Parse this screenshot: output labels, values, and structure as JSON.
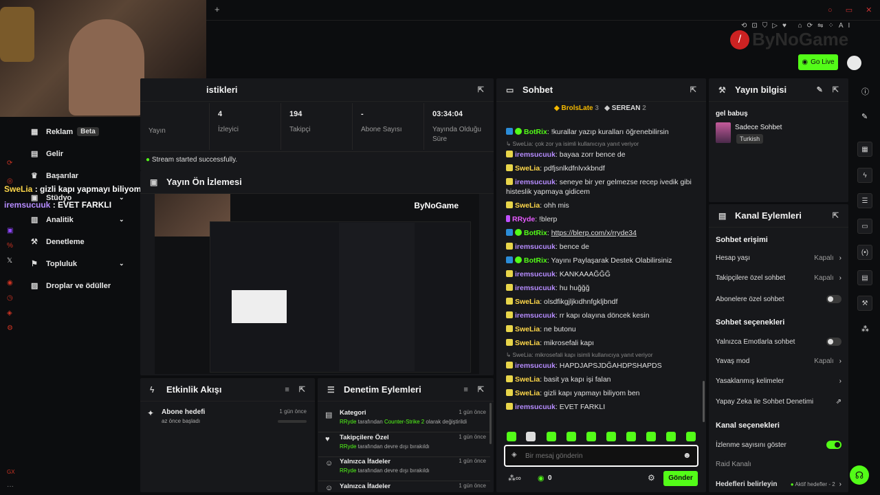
{
  "topbar": {
    "plus_icon": "plus-icon",
    "brand": "ByNoGame",
    "go_live_label": "Go Live",
    "ai_label": "AI"
  },
  "stats": {
    "title": "istikleri",
    "items": [
      {
        "value": "4",
        "label": "İzleyici"
      },
      {
        "value": "194",
        "label": "Takipçi"
      },
      {
        "value": "-",
        "label": "Abone Sayısı"
      },
      {
        "value": "03:34:04",
        "label": "Yayında Olduğu Süre"
      }
    ],
    "yayin_label": "Yayın",
    "status_message": "Stream started successfully."
  },
  "preview": {
    "title": "Yayın Ön İzlemesi",
    "brand": "ByNoGame"
  },
  "sidebar": {
    "items": [
      {
        "label": "Reklam",
        "badge": "Beta"
      },
      {
        "label": "Gelir"
      },
      {
        "label": "Başarılar"
      },
      {
        "label": "Stüdyo"
      },
      {
        "label": "Analitik"
      },
      {
        "label": "Denetleme"
      },
      {
        "label": "Topluluk"
      },
      {
        "label": "Droplar ve ödüller"
      }
    ],
    "overlay": [
      {
        "user": "SweLia",
        "text": "gizli kapı yapmayı biliyom ben"
      },
      {
        "user": "iremsucuuk",
        "text": "EVET FARKLI"
      }
    ]
  },
  "activity": {
    "title": "Etkinlik Akışı",
    "item_title": "Abone hedefi",
    "item_sub": "az önce başladı",
    "item_time": "1 gün önce"
  },
  "moderation": {
    "title": "Denetim Eylemleri",
    "items": [
      {
        "title": "Kategori",
        "user": "RRyde",
        "mid": " tarafından ",
        "hl": "Counter-Strike 2",
        "tail": " olarak değiştirildi",
        "time": "1 gün önce"
      },
      {
        "title": "Takipçilere Özel",
        "user": "RRyde",
        "mid": " tarafından devre dışı bırakıldı",
        "hl": "",
        "tail": "",
        "time": "1 gün önce"
      },
      {
        "title": "Yalnızca İfadeler",
        "user": "RRyde",
        "mid": " tarafından devre dışı bırakıldı",
        "hl": "",
        "tail": "",
        "time": "1 gün önce"
      },
      {
        "title": "Yalnızca İfadeler",
        "user": "",
        "mid": "",
        "hl": "",
        "tail": "",
        "time": "1 gün önce"
      }
    ]
  },
  "chat": {
    "title": "Sohbet",
    "leaders": [
      {
        "name": "BrolsLate",
        "count": "3"
      },
      {
        "name": "SEREAN",
        "count": "2"
      }
    ],
    "messages": [
      {
        "user": "BotRix",
        "color": "#53fc18",
        "text": "!kurallar yazıp kuralları öğrenebilirsin",
        "reply": ""
      },
      {
        "user": "iremsucuuk",
        "color": "#b68cff",
        "text": "bayaa zorr bence de",
        "reply": "SweLia: çok zor ya isimli kullanıcıya yanıt veriyor"
      },
      {
        "user": "SweLia",
        "color": "#ffd84a",
        "text": "pdfjsnlkdfnlvxkbndf",
        "reply": ""
      },
      {
        "user": "iremsucuuk",
        "color": "#b68cff",
        "text": "seneye bir yer gelmezse recep ivedik gibi histeslik yapmaya gidicem",
        "reply": ""
      },
      {
        "user": "SweLia",
        "color": "#ffd84a",
        "text": "ohh mis",
        "reply": ""
      },
      {
        "user": "RRyde",
        "color": "#e65bff",
        "text": "!blerp",
        "reply": ""
      },
      {
        "user": "BotRix",
        "color": "#53fc18",
        "text": "https://blerp.com/x/rryde34",
        "reply": ""
      },
      {
        "user": "iremsucuuk",
        "color": "#b68cff",
        "text": "bence de",
        "reply": ""
      },
      {
        "user": "BotRix",
        "color": "#53fc18",
        "text": "Yayını Paylaşarak Destek Olabilirsiniz",
        "reply": ""
      },
      {
        "user": "iremsucuuk",
        "color": "#b68cff",
        "text": "KANKAAAĞĞĞ",
        "reply": ""
      },
      {
        "user": "iremsucuuk",
        "color": "#b68cff",
        "text": "hu huğğğ",
        "reply": ""
      },
      {
        "user": "SweLia",
        "color": "#ffd84a",
        "text": "olsdfikgjljkıdhnfgkljbndf",
        "reply": ""
      },
      {
        "user": "iremsucuuk",
        "color": "#b68cff",
        "text": "rr kapı olayına döncek kesin",
        "reply": ""
      },
      {
        "user": "SweLia",
        "color": "#ffd84a",
        "text": "ne butonu",
        "reply": ""
      },
      {
        "user": "SweLia",
        "color": "#ffd84a",
        "text": "mikrosefali kapı",
        "reply": ""
      },
      {
        "user": "iremsucuuk",
        "color": "#b68cff",
        "text": "HAPDJAPSJDĞAHDPSHAPDS",
        "reply": "SweLia: mikrosefali kapı isimli kullanıcıya yanıt veriyor"
      },
      {
        "user": "SweLia",
        "color": "#ffd84a",
        "text": "basit ya kapı işi falan",
        "reply": ""
      },
      {
        "user": "SweLia",
        "color": "#ffd84a",
        "text": "gizli kapı yapmayı biliyom ben",
        "reply": ""
      },
      {
        "user": "iremsucuuk",
        "color": "#b68cff",
        "text": "EVET FARKLI",
        "reply": ""
      }
    ],
    "input_placeholder": "Bir mesaj gönderin",
    "points": "0",
    "send_label": "Gönder"
  },
  "stream_info": {
    "title": "Yayın bilgisi",
    "stream_title": "gel babuş",
    "category": "Sadece Sohbet",
    "language": "Turkish"
  },
  "channel_actions": {
    "title": "Kanal Eylemleri",
    "chat_access": "Sohbet erişimi",
    "account_age": "Hesap yaşı",
    "account_age_value": "Kapalı",
    "followers_only": "Takipçilere özel sohbet",
    "followers_only_value": "Kapalı",
    "subs_only": "Abonelere özel sohbet",
    "chat_options": "Sohbet seçenekleri",
    "emotes_only": "Yalnızca Emotlarla sohbet",
    "slow_mode": "Yavaş mod",
    "slow_mode_value": "Kapalı",
    "banned_words": "Yasaklanmış kelimeler",
    "ai_moderation": "Yapay Zeka ile Sohbet Denetimi",
    "channel_options": "Kanal seçenekleri",
    "show_viewers": "İzlenme sayısını göster",
    "raid": "Raid Kanalı",
    "goals": "Hedefleri belirleyin",
    "goals_value": "Aktif hedefler - 2"
  },
  "colors": {
    "accent": "#53fc18"
  }
}
